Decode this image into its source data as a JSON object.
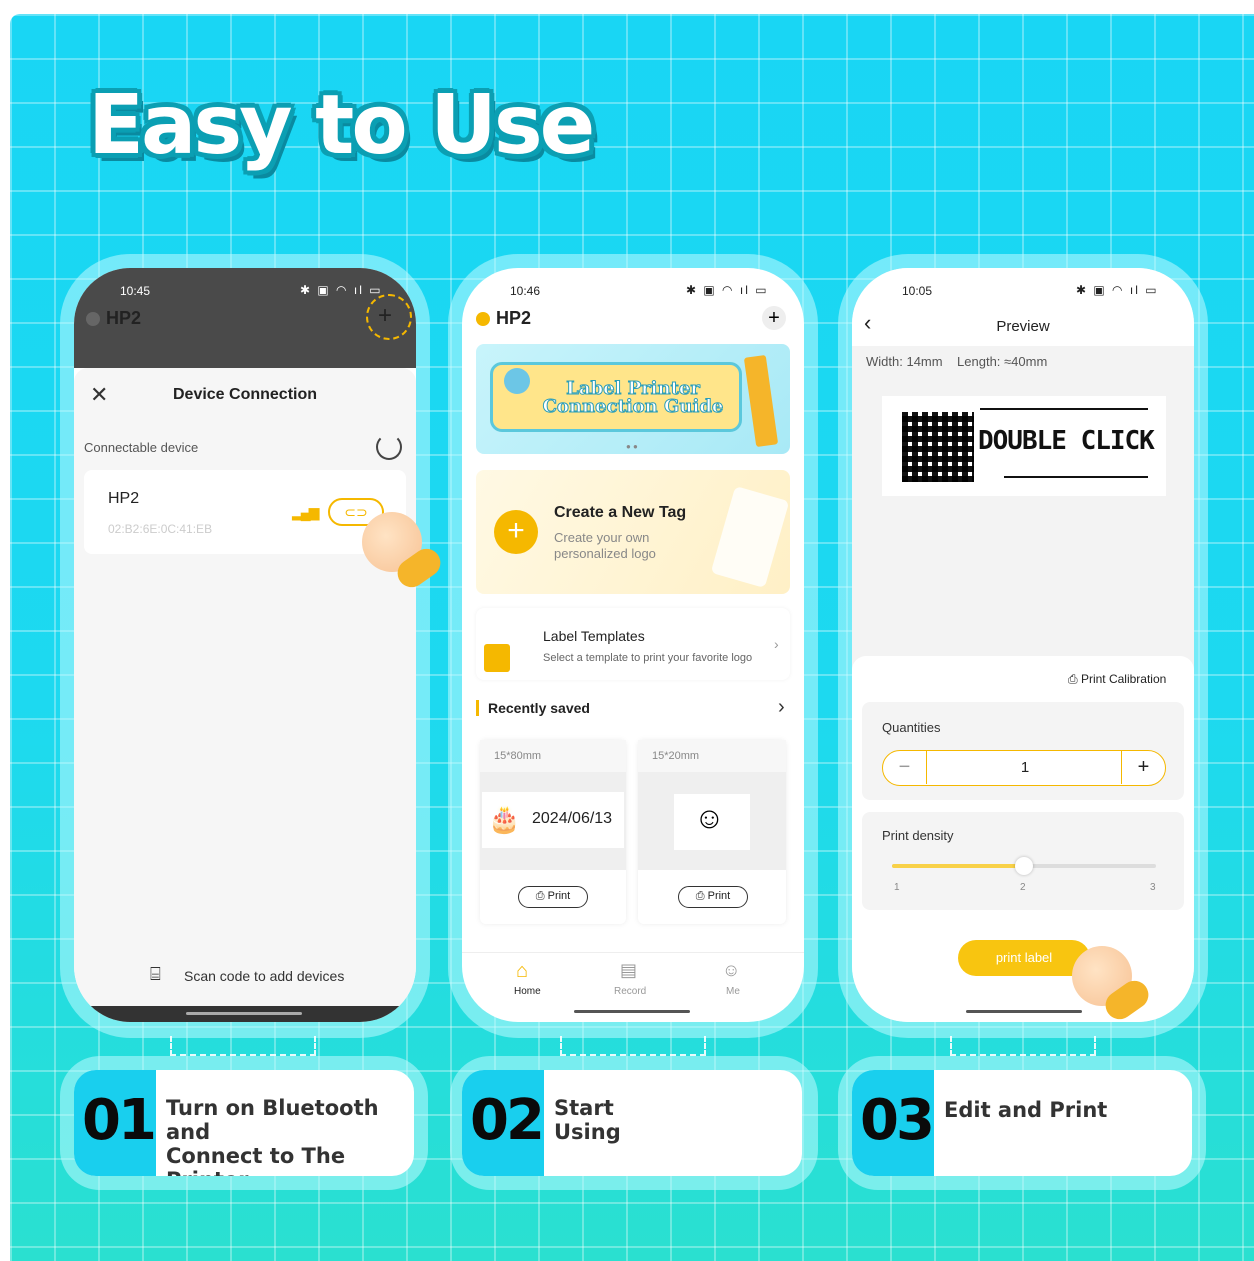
{
  "headline": "Easy to Use",
  "phone1": {
    "time": "10:45",
    "device_name": "HP2",
    "sheet_title": "Device Connection",
    "section_label": "Connectable device",
    "device_item_name": "HP2",
    "device_mac": "02:B2:6E:0C:41:EB",
    "scan_label": "Scan code to add devices"
  },
  "phone2": {
    "time": "10:46",
    "device_name": "HP2",
    "banner_line1": "Label Printer",
    "banner_line2": "Connection Guide",
    "create_title": "Create a New Tag",
    "create_sub1": "Create your own",
    "create_sub2": "personalized logo",
    "templates_title": "Label Templates",
    "templates_sub": "Select a template to print your favorite logo",
    "recent_title": "Recently saved",
    "cards": [
      {
        "size": "15*80mm",
        "content": "2024/06/13",
        "print": "Print"
      },
      {
        "size": "15*20mm",
        "content": "",
        "print": "Print"
      }
    ],
    "nav": [
      {
        "label": "Home"
      },
      {
        "label": "Record"
      },
      {
        "label": "Me"
      }
    ]
  },
  "phone3": {
    "time": "10:05",
    "title": "Preview",
    "width_label": "Width:",
    "width_value": "14mm",
    "length_label": "Length:",
    "length_value": "≈40mm",
    "label_text": "DOUBLE CLICK",
    "calibration": "Print Calibration",
    "quantities_label": "Quantities",
    "quantity": "1",
    "density_label": "Print density",
    "density_ticks": [
      "1",
      "2",
      "3"
    ],
    "density_level": 2,
    "print_button": "print label"
  },
  "steps": [
    {
      "num": "01",
      "line1": "Turn on Bluetooth and",
      "line2": "Connect to The Printer"
    },
    {
      "num": "02",
      "line1": "Start",
      "line2": "Using"
    },
    {
      "num": "03",
      "line1": "Edit and Print",
      "line2": ""
    }
  ],
  "colors": {
    "accent_yellow": "#f5b800",
    "cyan_bg": "#19d6f4"
  }
}
